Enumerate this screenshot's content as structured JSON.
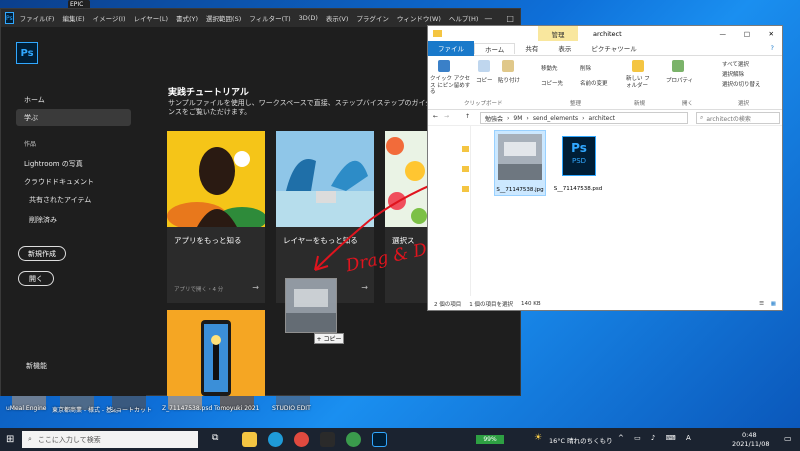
{
  "desktop": {
    "icons": [
      {
        "label": "EPIC"
      },
      {
        "label": "uMeal Engine"
      },
      {
        "label": "東京都商業 - 様式 - 基礎"
      },
      {
        "label": "ショートカット"
      },
      {
        "label": "Z_71147538.psd"
      },
      {
        "label": "Tomoyuki 2021"
      },
      {
        "label": "STUDIO EDIT"
      }
    ]
  },
  "photoshop": {
    "menu": [
      "ファイル(F)",
      "編集(E)",
      "イメージ(I)",
      "レイヤー(L)",
      "書式(Y)",
      "選択範囲(S)",
      "フィルター(T)",
      "3D(D)",
      "表示(V)",
      "プラグイン",
      "ウィンドウ(W)",
      "ヘルプ(H)"
    ],
    "logo": "Ps",
    "sidebar": {
      "home": "ホーム",
      "learn": "学ぶ",
      "work_heading": "作品",
      "lightroom": "Lightroom の写真",
      "cloud_docs": "クラウドドキュメント",
      "shared": "共有されたアイテム",
      "deleted": "削除済み",
      "new_btn": "新規作成",
      "open_btn": "開く",
      "whats_new": "新機能"
    },
    "main": {
      "title": "実践チュートリアル",
      "description": "サンプルファイルを使用し、ワークスペースで直接、ステップバイステップのガイダンスをご覧いただけます。",
      "cards": [
        {
          "title": "アプリをもっと知る",
          "sub": "アプリで開く・4 分"
        },
        {
          "title": "レイヤーをもっと知る",
          "sub": ""
        },
        {
          "title": "選択ス",
          "sub": ""
        }
      ]
    },
    "drag": {
      "copy_tip": "+ コピー",
      "annotation": "Drag & Drop"
    }
  },
  "explorer": {
    "title": "architect",
    "context_tab": "管理",
    "tabs": [
      "ファイル",
      "ホーム",
      "共有",
      "表示",
      "ピクチャツール"
    ],
    "ribbon": {
      "quick_access": "クイック アクセス にピン留めする",
      "copy": "コピー",
      "paste": "貼り付け",
      "move_to": "移動先",
      "delete": "削除",
      "copy_to": "コピー先",
      "rename": "名前の変更",
      "new_folder": "新しい フォルダー",
      "properties": "プロパティ",
      "select_all": "すべて選択",
      "select_none": "選択解除",
      "invert": "選択の切り替え",
      "groups": [
        "クリップボード",
        "整理",
        "新規",
        "開く",
        "選択"
      ]
    },
    "address": {
      "path": [
        "勉強会",
        "9M",
        "send_elements",
        "architect"
      ],
      "search_placeholder": "architectの検索"
    },
    "files": [
      {
        "name": "S__71147538.jpg"
      },
      {
        "name": "S__71147538.psd",
        "icon_text": "Ps",
        "icon_sub": "PSD"
      }
    ],
    "status": {
      "count": "2 個の項目",
      "selected": "1 個の項目を選択",
      "size": "140 KB"
    }
  },
  "taskbar": {
    "search_placeholder": "ここに入力して検索",
    "battery": "99%",
    "weather": "16°C 晴れのちくもり",
    "time": "0:48",
    "date": "2021/11/08"
  }
}
